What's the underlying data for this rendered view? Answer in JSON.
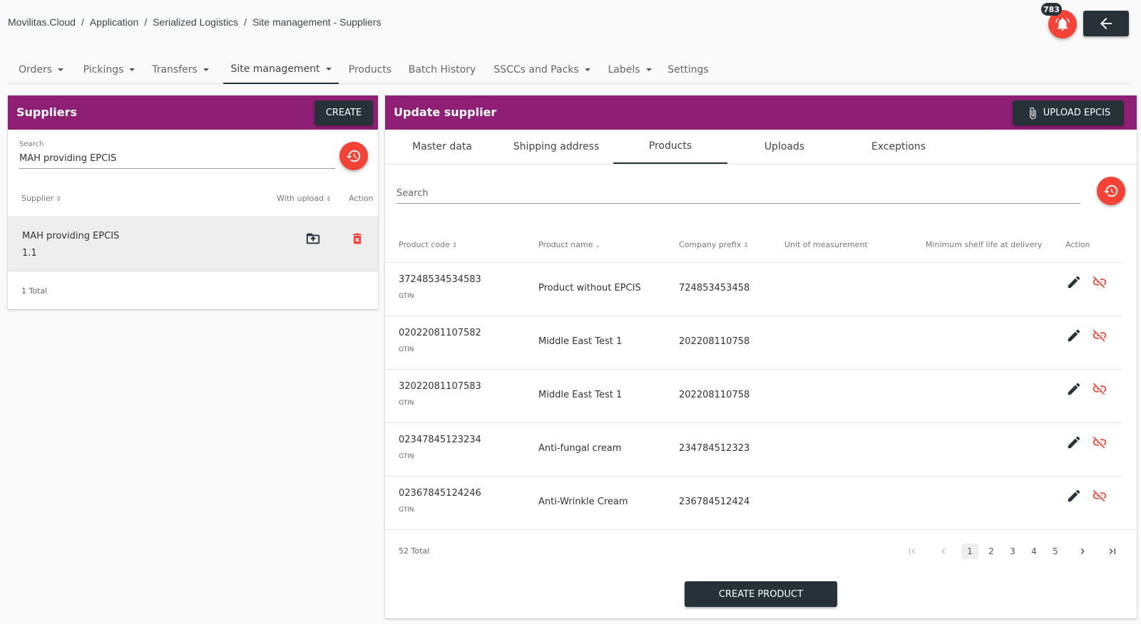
{
  "breadcrumb": [
    "Movilitas.Cloud",
    "Application",
    "Serialized Logistics",
    "Site management - Suppliers"
  ],
  "notifications": {
    "count": "783"
  },
  "nav": [
    {
      "label": "Orders",
      "dropdown": true
    },
    {
      "label": "Pickings",
      "dropdown": true
    },
    {
      "label": "Transfers",
      "dropdown": true
    },
    {
      "label": "Site management",
      "dropdown": true,
      "active": true
    },
    {
      "label": "Products",
      "dropdown": false
    },
    {
      "label": "Batch History",
      "dropdown": false
    },
    {
      "label": "SSCCs and Packs",
      "dropdown": true
    },
    {
      "label": "Labels",
      "dropdown": true
    },
    {
      "label": "Settings",
      "dropdown": false
    }
  ],
  "suppliers": {
    "title": "Suppliers",
    "create_label": "CREATE",
    "search_label": "Search",
    "search_value": "MAH providing EPCIS",
    "columns": [
      "Supplier",
      "With upload",
      "Action"
    ],
    "rows": [
      {
        "name": "MAH providing EPCIS",
        "version": "1.1"
      }
    ],
    "total": "1 Total"
  },
  "update": {
    "title": "Update supplier",
    "upload_label": "UPLOAD EPCIS",
    "tabs": [
      "Master data",
      "Shipping address",
      "Products",
      "Uploads",
      "Exceptions"
    ],
    "active_tab": "Products",
    "search_placeholder": "Search",
    "columns": [
      "Product code",
      "Product name",
      "Company prefix",
      "Unit of measurement",
      "Minimum shelf life at delivery",
      "Action"
    ],
    "rows": [
      {
        "code": "37248534534583",
        "type": "GTIN",
        "name": "Product without EPCIS",
        "prefix": "724853453458"
      },
      {
        "code": "02022081107582",
        "type": "GTIN",
        "name": "Middle East Test 1",
        "prefix": "202208110758"
      },
      {
        "code": "32022081107583",
        "type": "GTIN",
        "name": "Middle East Test 1",
        "prefix": "202208110758"
      },
      {
        "code": "02347845123234",
        "type": "GTIN",
        "name": "Anti-fungal cream",
        "prefix": "234784512323"
      },
      {
        "code": "02367845124246",
        "type": "GTIN",
        "name": "Anti-Wrinkle Cream",
        "prefix": "236784512424"
      }
    ],
    "total": "52 Total",
    "pages": [
      "1",
      "2",
      "3",
      "4",
      "5"
    ],
    "current_page": "1",
    "create_product_label": "CREATE PRODUCT"
  },
  "colors": {
    "header": "#8e1f74",
    "accent": "#f44336",
    "dark": "#263238"
  }
}
